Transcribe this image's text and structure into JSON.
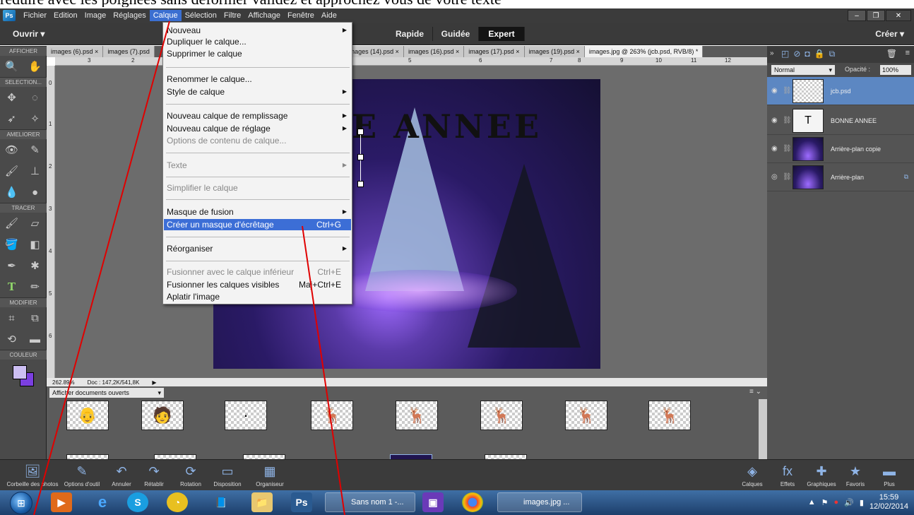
{
  "caption": "réduire avec les poignées sans déformer validez et approchez vous de votre texte",
  "menubar": {
    "items": [
      "Fichier",
      "Edition",
      "Image",
      "Réglages",
      "Calque",
      "Sélection",
      "Filtre",
      "Affichage",
      "Fenêtre",
      "Aide"
    ],
    "active": "Calque"
  },
  "modebar": {
    "open": "Ouvrir",
    "tabs": [
      "Rapide",
      "Guidée",
      "Expert"
    ],
    "active_tab": "Expert",
    "create": "Créer"
  },
  "tool_sections": [
    "AFFICHER",
    "SELECTION...",
    "AMELIORER",
    "TRACER",
    "MODIFIER",
    "COULEUR"
  ],
  "colors": {
    "foreground": "#cdbff3",
    "background": "#7b3fe0",
    "menu_highlight": "#3c6ed6",
    "layer_selected": "#5c87c2"
  },
  "doc_tabs": [
    "images (6).psd",
    "images (7).psd",
    "images (14).psd",
    "images (16).psd",
    "images (17).psd",
    "images (19).psd",
    "images.jpg @ 263% (jcb.psd, RVB/8) *"
  ],
  "ruler_marks": [
    "3",
    "2",
    "4",
    "5",
    "6",
    "7",
    "8",
    "9",
    "10",
    "11",
    "12"
  ],
  "ruler_v_marks": [
    "0",
    "1",
    "2",
    "3",
    "4",
    "5",
    "6"
  ],
  "canvas_text": "NE ANNEE",
  "status": {
    "zoom": "262.89%",
    "doc": "Doc : 147,2K/541,8K"
  },
  "photo_bin": {
    "dropdown": "Afficher documents ouverts"
  },
  "layers": {
    "blend_mode": "Normal",
    "opacity_label": "Opacité :",
    "opacity_value": "100%",
    "items": [
      "jcb.psd",
      "BONNE ANNEE",
      "Arrière-plan copie",
      "Arrière-plan"
    ]
  },
  "calque_menu": {
    "items": [
      {
        "label": "Nouveau",
        "submenu": true
      },
      {
        "label": "Dupliquer le calque..."
      },
      {
        "label": "Supprimer le calque"
      },
      {
        "label": "Renommer le calque..."
      },
      {
        "label": "Style de calque",
        "submenu": true
      },
      {
        "label": "Nouveau calque de remplissage",
        "submenu": true
      },
      {
        "label": "Nouveau calque de réglage",
        "submenu": true
      },
      {
        "label": "Options de contenu de calque...",
        "disabled": true
      },
      {
        "label": "Texte",
        "submenu": true,
        "disabled": true
      },
      {
        "label": "Simplifier le calque",
        "disabled": true
      },
      {
        "label": "Masque de fusion",
        "submenu": true
      },
      {
        "label": "Créer un masque d'écrêtage",
        "shortcut": "Ctrl+G",
        "highlight": true
      },
      {
        "label": "Réorganiser",
        "submenu": true
      },
      {
        "label": "Fusionner avec le calque inférieur",
        "shortcut": "Ctrl+E",
        "disabled": true
      },
      {
        "label": "Fusionner les calques visibles",
        "shortcut": "Maj+Ctrl+E"
      },
      {
        "label": "Aplatir l'image"
      }
    ]
  },
  "bottom_left": [
    "Corbeille des photos",
    "Options d'outil",
    "Annuler",
    "Rétablir",
    "Rotation",
    "Disposition",
    "Organiseur"
  ],
  "bottom_right": [
    "Calques",
    "Effets",
    "Graphiques",
    "Favoris",
    "Plus"
  ],
  "taskbar": {
    "tasks": [
      "Sans nom 1 -...",
      "images.jpg ..."
    ],
    "time": "15:59",
    "date": "12/02/2014"
  }
}
